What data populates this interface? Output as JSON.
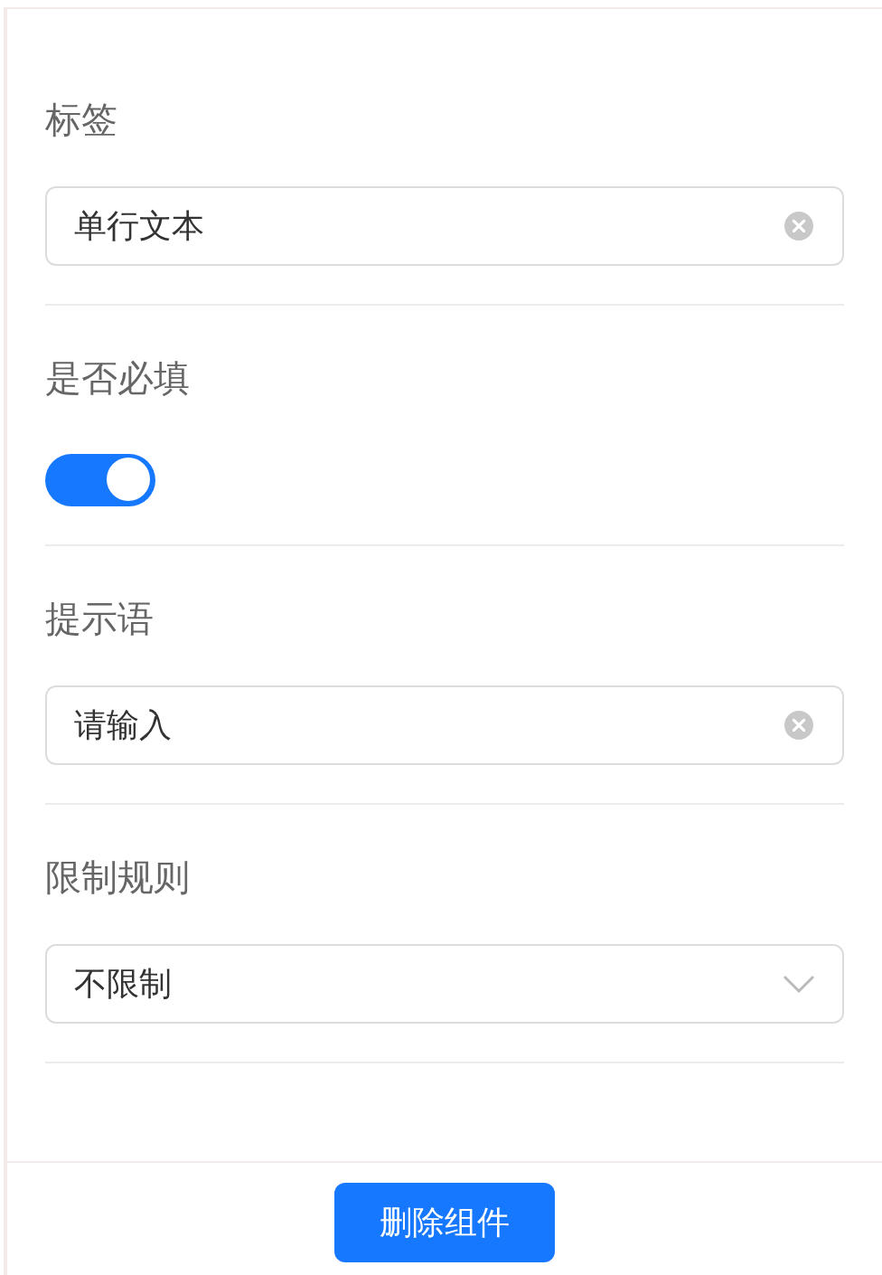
{
  "fields": [
    {
      "kind": "input",
      "label": "标签",
      "value": "单行文本"
    },
    {
      "kind": "switch",
      "label": "是否必填",
      "on": true
    },
    {
      "kind": "input",
      "label": "提示语",
      "value": "请输入"
    },
    {
      "kind": "select",
      "label": "限制规则",
      "value": "不限制"
    }
  ],
  "footer": {
    "button": "删除组件"
  }
}
